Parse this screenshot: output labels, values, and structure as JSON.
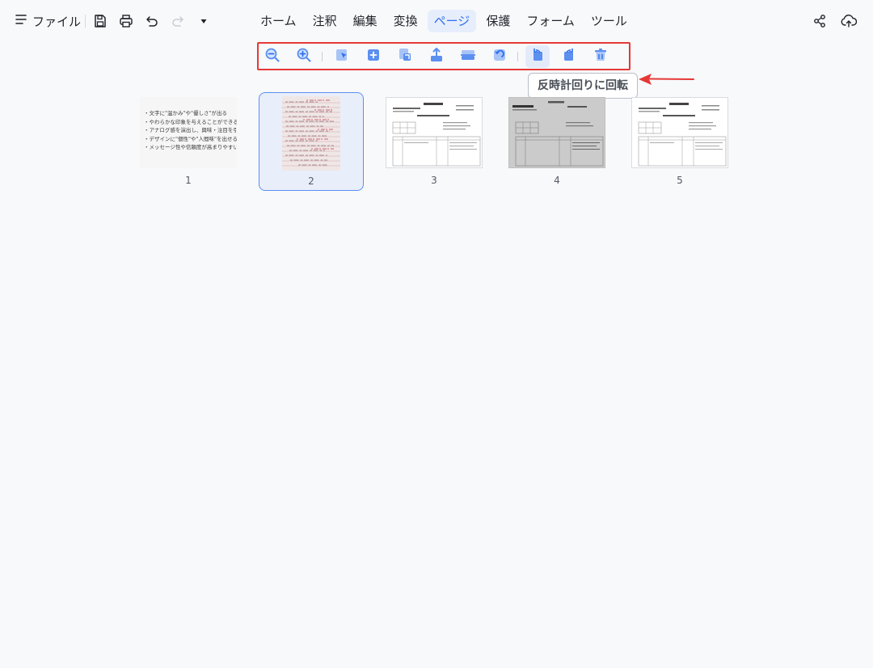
{
  "topbar": {
    "file_label": "ファイル",
    "menu_tabs": [
      "ホーム",
      "注釈",
      "編集",
      "変換",
      "ページ",
      "保護",
      "フォーム",
      "ツール"
    ],
    "active_tab": "ページ"
  },
  "toolbar": {
    "tooltip": "反時計回りに回転"
  },
  "thumbnails": [
    {
      "number": "1",
      "lines": [
        "・文字に\"温かみ\"や\"優しさ\"が出る",
        "・やわらかな印象を与えることができる",
        "・アナログ感を演出し、興味・注目を引く",
        "・デザインに\"個性\"や\"人間味\"を出せる",
        "・メッセージ性や信頼度が高まりやすい"
      ]
    },
    {
      "number": "2"
    },
    {
      "number": "3"
    },
    {
      "number": "4"
    },
    {
      "number": "5"
    }
  ],
  "colors": {
    "accent": "#2f6fed",
    "highlight_border": "#e53935",
    "icon_blue": "#5b8ff0"
  }
}
